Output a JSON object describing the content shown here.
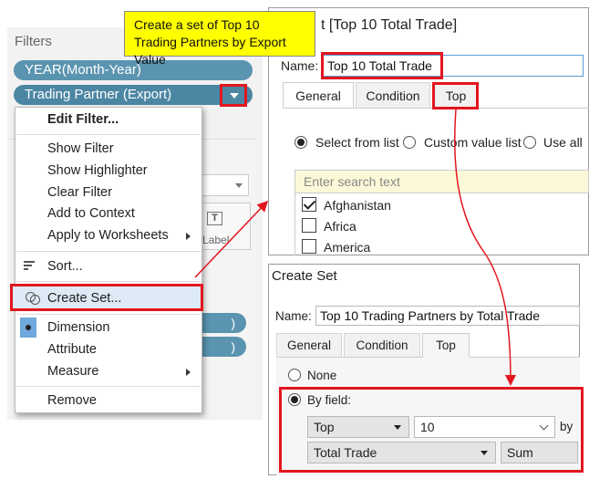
{
  "callout": {
    "text": "Create a set of Top 10 Trading Partners by Export Value"
  },
  "filters": {
    "title": "Filters",
    "pills": [
      "YEAR(Month-Year)",
      "Trading Partner (Export)"
    ]
  },
  "background": {
    "label_text": "Label",
    "t_icon": "T",
    "pill_tail": ")"
  },
  "context_menu": {
    "edit_filter": "Edit Filter...",
    "show_filter": "Show Filter",
    "show_highlighter": "Show Highlighter",
    "clear_filter": "Clear Filter",
    "add_to_context": "Add to Context",
    "apply_to_worksheets": "Apply to Worksheets",
    "sort": "Sort...",
    "create_set": "Create Set...",
    "dimension": "Dimension",
    "attribute": "Attribute",
    "measure": "Measure",
    "remove": "Remove"
  },
  "edit_set_dialog": {
    "title": "t [Top 10 Total Trade]",
    "name_label": "Name:",
    "name_value": "Top 10 Total Trade",
    "tabs": [
      "General",
      "Condition",
      "Top"
    ],
    "radio_select_from_list": "Select from list",
    "radio_custom_value_list": "Custom value list",
    "radio_use_all": "Use all",
    "search_placeholder": "Enter search text",
    "list_items": [
      {
        "label": "Afghanistan",
        "checked": true
      },
      {
        "label": "Africa",
        "checked": false
      },
      {
        "label": "America",
        "checked": false
      }
    ]
  },
  "create_set_dialog": {
    "title": "Create Set",
    "name_label": "Name:",
    "name_value": "Top 10 Trading Partners by Total Trade",
    "tabs": [
      "General",
      "Condition",
      "Top"
    ],
    "radio_none": "None",
    "radio_by_field": "By field:",
    "top_select": "Top",
    "count_value": "10",
    "by_label": "by",
    "field_select": "Total Trade",
    "aggregation_select": "Sum"
  },
  "colors": {
    "highlight_red": "#e2161f",
    "callout_yellow": "#ffff00",
    "pill_blue": "#5a94b0"
  }
}
